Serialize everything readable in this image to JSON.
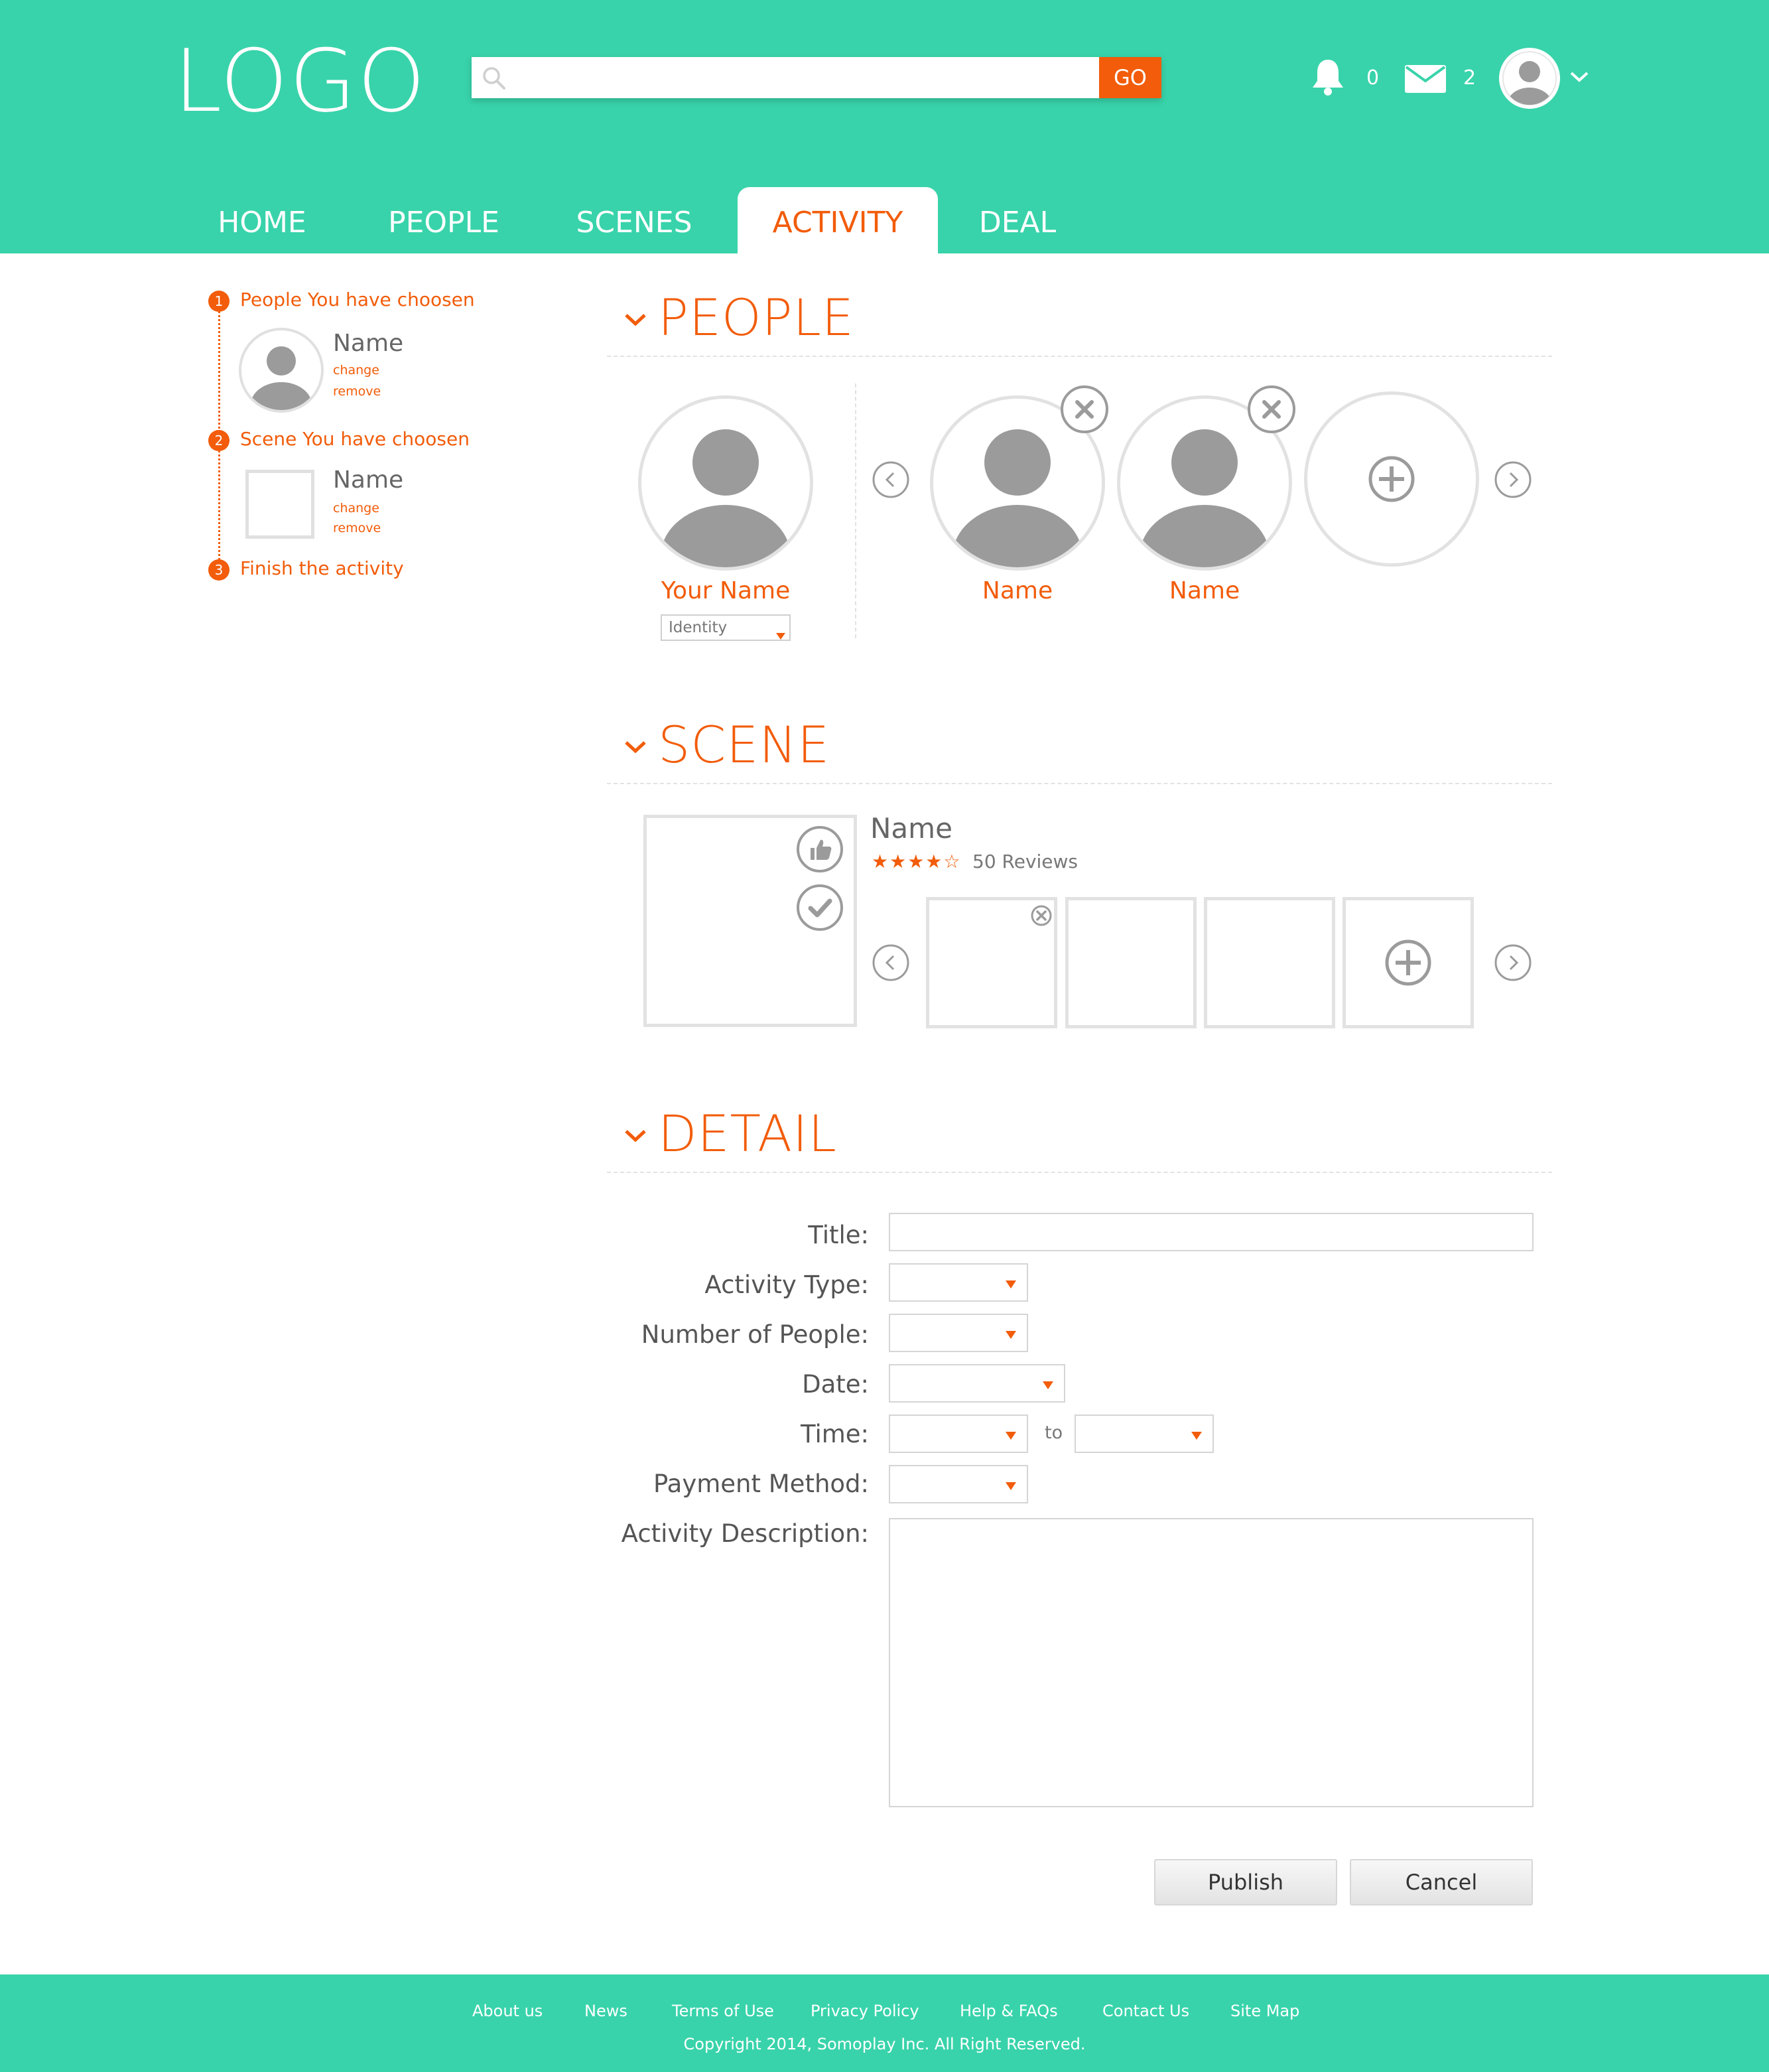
{
  "header": {
    "logo": "LOGO",
    "search": {
      "placeholder": "",
      "button_label": "GO"
    },
    "notifications_count": "0",
    "messages_count": "2"
  },
  "nav": {
    "tabs": [
      {
        "label": "HOME"
      },
      {
        "label": "PEOPLE"
      },
      {
        "label": "SCENES"
      },
      {
        "label": "ACTIVITY",
        "active": true
      },
      {
        "label": "DEAL"
      }
    ]
  },
  "steps": [
    {
      "num": "1",
      "label": "People You have choosen",
      "item_name": "Name",
      "change": "change",
      "remove": "remove"
    },
    {
      "num": "2",
      "label": "Scene You have choosen",
      "item_name": "Name",
      "change": "change",
      "remove": "remove"
    },
    {
      "num": "3",
      "label": "Finish the activity"
    }
  ],
  "people_section": {
    "title": "PEOPLE",
    "self": {
      "name": "Your Name",
      "identity_placeholder": "Identity"
    },
    "others": [
      {
        "name": "Name"
      },
      {
        "name": "Name"
      }
    ]
  },
  "scene_section": {
    "title": "SCENE",
    "name": "Name",
    "stars": "★★★★☆",
    "rating": 4,
    "reviews": "50 Reviews"
  },
  "detail_section": {
    "title": "DETAIL",
    "labels": {
      "title": "Title:",
      "activity_type": "Activity Type:",
      "number_of_people": "Number of People:",
      "date": "Date:",
      "time": "Time:",
      "time_to": "to",
      "payment_method": "Payment Method:",
      "description": "Activity Description:"
    },
    "publish_label": "Publish",
    "cancel_label": "Cancel"
  },
  "footer": {
    "links": [
      "About us",
      "News",
      "Terms of Use",
      "Privacy Policy",
      "Help & FAQs",
      "Contact Us",
      "Site Map"
    ],
    "copyright": "Copyright 2014, Somoplay Inc. All Right Reserved."
  },
  "colors": {
    "accent": "#f25c0a",
    "brand": "#38d3aa",
    "border": "#e2e2e2",
    "avatar": "#9b9b9b"
  }
}
